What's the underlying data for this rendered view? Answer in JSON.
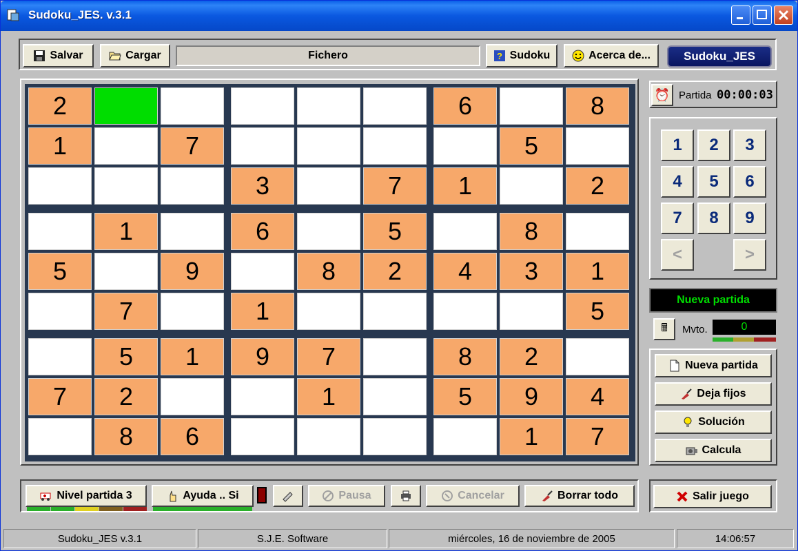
{
  "window": {
    "title": "Sudoku_JES. v.3.1"
  },
  "toolbar": {
    "save_label": "Salvar",
    "load_label": "Cargar",
    "file_label": "Fichero",
    "sudoku_label": "Sudoku",
    "about_label": "Acerca de...",
    "brand_label": "Sudoku_JES"
  },
  "grid": [
    [
      "2",
      "",
      "",
      "",
      "",
      "",
      "6",
      "",
      "8"
    ],
    [
      "1",
      "",
      "7",
      "",
      "",
      "",
      "",
      "5",
      ""
    ],
    [
      "",
      "",
      "",
      "3",
      "",
      "7",
      "1",
      "",
      "2"
    ],
    [
      "",
      "1",
      "",
      "6",
      "",
      "5",
      "",
      "8",
      ""
    ],
    [
      "5",
      "",
      "9",
      "",
      "8",
      "2",
      "4",
      "3",
      "1"
    ],
    [
      "",
      "7",
      "",
      "1",
      "",
      "",
      "",
      "",
      "5"
    ],
    [
      "",
      "5",
      "1",
      "9",
      "7",
      "",
      "8",
      "2",
      ""
    ],
    [
      "7",
      "2",
      "",
      "",
      "1",
      "",
      "5",
      "9",
      "4"
    ],
    [
      "",
      "8",
      "6",
      "",
      "",
      "",
      "",
      "1",
      "7"
    ]
  ],
  "selected_cell": {
    "row": 0,
    "col": 1
  },
  "timer": {
    "label": "Partida",
    "value": "00:00:03"
  },
  "numpad": [
    "1",
    "2",
    "3",
    "4",
    "5",
    "6",
    "7",
    "8",
    "9"
  ],
  "nav": {
    "prev": "<",
    "next": ">"
  },
  "status_message": "Nueva partida",
  "moves": {
    "label": "Mvto.",
    "value": "0"
  },
  "actions": {
    "new_game": "Nueva partida",
    "leave_fixed": "Deja fijos",
    "solution": "Solución",
    "calculate": "Calcula"
  },
  "bottom": {
    "level": "Nivel partida 3",
    "help": "Ayuda .. Si",
    "pause": "Pausa",
    "cancel": "Cancelar",
    "clear_all": "Borrar todo",
    "exit": "Salir juego"
  },
  "statusbar": {
    "app": "Sudoku_JES  v.3.1",
    "company": "S.J.E. Software",
    "date": "miércoles, 16 de noviembre de 2005",
    "time": "14:06:57"
  },
  "colors": {
    "fixed_cell": "#f7a86a",
    "selected_cell": "#00dd00",
    "status_text": "#00dd00"
  }
}
